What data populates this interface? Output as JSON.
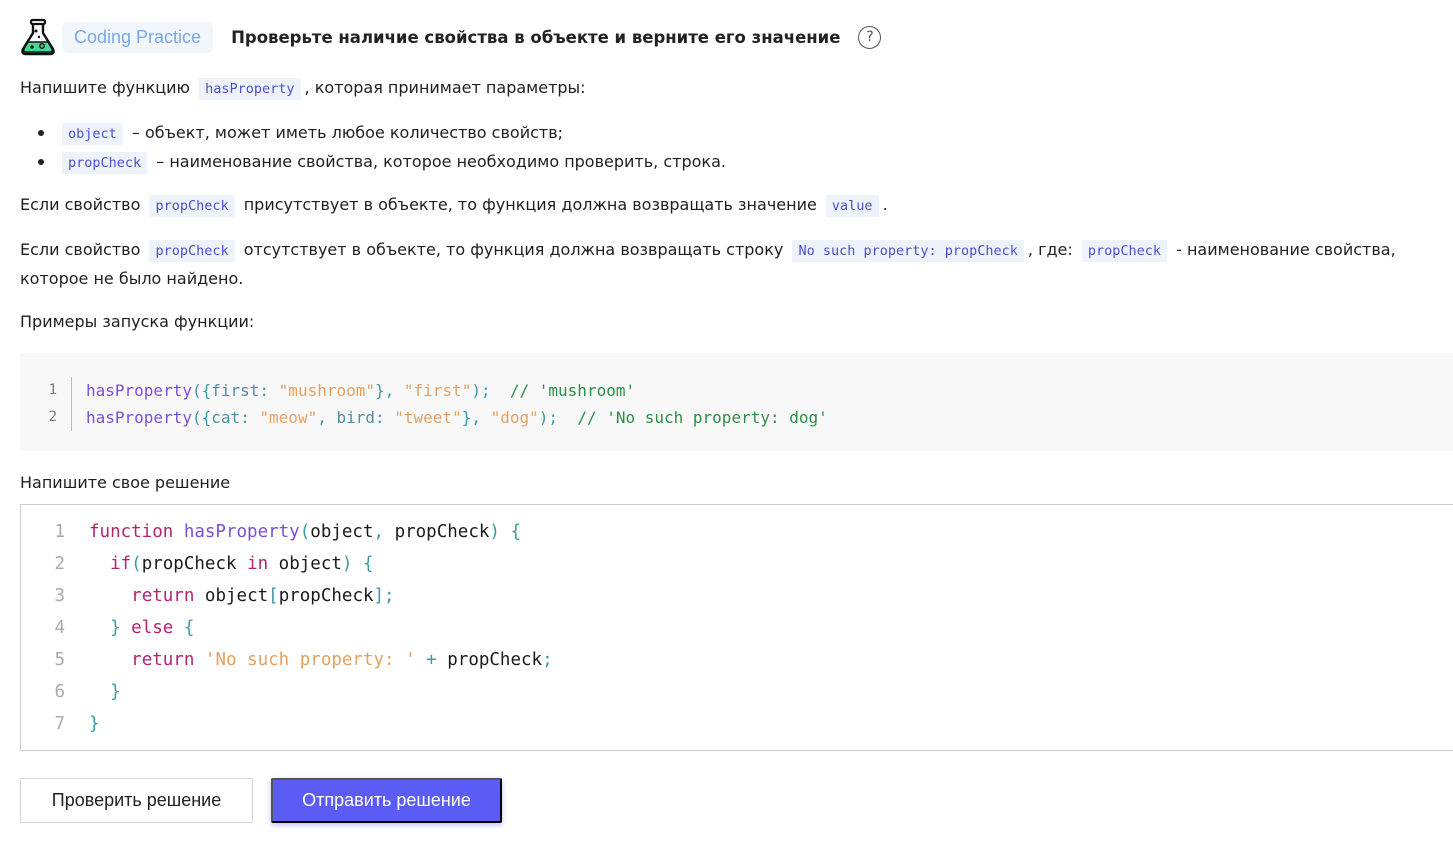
{
  "header": {
    "badge": "Coding Practice",
    "title": "Проверьте наличие свойства в объекте и верните его значение",
    "help_icon": "?"
  },
  "intro": {
    "before": "Напишите функцию",
    "code": "hasProperty",
    "after": ", которая принимает параметры:"
  },
  "params": [
    {
      "code": "object",
      "text": "– объект, может иметь любое количество свойств;"
    },
    {
      "code": "propCheck",
      "text": "– наименование свойства, которое необходимо проверить, строка."
    }
  ],
  "rule1": {
    "a": "Если свойство",
    "code1": "propCheck",
    "b": "присутствует в объекте, то функция должна возвращать значение",
    "code2": "value",
    "c": "."
  },
  "rule2": {
    "a": "Если свойство",
    "code1": "propCheck",
    "b": "отсутствует в объекте, то функция должна возвращать строку",
    "code2": "No such property: propCheck",
    "c": ", где:",
    "code3": "propCheck",
    "d": "- наименование свойства,",
    "e": "которое не было найдено."
  },
  "examples_label": "Примеры запуска функции:",
  "examples": [
    {
      "num": "1",
      "tokens": [
        [
          "fn",
          "hasProperty"
        ],
        [
          "punc",
          "({"
        ],
        [
          "key",
          "first: "
        ],
        [
          "str",
          "\"mushroom\""
        ],
        [
          "punc",
          "}, "
        ],
        [
          "str",
          "\"first\""
        ],
        [
          "punc",
          ");  "
        ],
        [
          "com",
          "// 'mushroom'"
        ]
      ]
    },
    {
      "num": "2",
      "tokens": [
        [
          "fn",
          "hasProperty"
        ],
        [
          "punc",
          "({"
        ],
        [
          "key",
          "cat: "
        ],
        [
          "str",
          "\"meow\""
        ],
        [
          "punc",
          ", "
        ],
        [
          "key",
          "bird: "
        ],
        [
          "str",
          "\"tweet\""
        ],
        [
          "punc",
          "}, "
        ],
        [
          "str",
          "\"dog\""
        ],
        [
          "punc",
          ");  "
        ],
        [
          "com",
          "// 'No such property: dog'"
        ]
      ]
    }
  ],
  "solution_label": "Напишите свое решение",
  "editor": [
    {
      "num": "1",
      "tokens": [
        [
          "kw",
          "function "
        ],
        [
          "fn",
          "hasProperty"
        ],
        [
          "punc",
          "("
        ],
        [
          "id",
          "object"
        ],
        [
          "punc",
          ", "
        ],
        [
          "id",
          "propCheck"
        ],
        [
          "punc",
          ") {"
        ]
      ]
    },
    {
      "num": "2",
      "tokens": [
        [
          "id",
          "  "
        ],
        [
          "kw",
          "if"
        ],
        [
          "punc",
          "("
        ],
        [
          "id",
          "propCheck "
        ],
        [
          "kw",
          "in "
        ],
        [
          "id",
          "object"
        ],
        [
          "punc",
          ") {"
        ]
      ]
    },
    {
      "num": "3",
      "tokens": [
        [
          "id",
          "    "
        ],
        [
          "kw",
          "return "
        ],
        [
          "id",
          "object"
        ],
        [
          "brk",
          "["
        ],
        [
          "id",
          "propCheck"
        ],
        [
          "brk",
          "];"
        ]
      ]
    },
    {
      "num": "4",
      "tokens": [
        [
          "id",
          "  "
        ],
        [
          "punc",
          "} "
        ],
        [
          "kw",
          "else "
        ],
        [
          "punc",
          "{"
        ]
      ]
    },
    {
      "num": "5",
      "tokens": [
        [
          "id",
          "    "
        ],
        [
          "kw",
          "return "
        ],
        [
          "str",
          "'No such property: '"
        ],
        [
          "punc",
          " + "
        ],
        [
          "id",
          "propCheck"
        ],
        [
          "punc",
          ";"
        ]
      ]
    },
    {
      "num": "6",
      "tokens": [
        [
          "id",
          "  "
        ],
        [
          "punc",
          "}"
        ]
      ]
    },
    {
      "num": "7",
      "tokens": [
        [
          "punc",
          "}"
        ]
      ]
    }
  ],
  "buttons": {
    "check": "Проверить решение",
    "submit": "Отправить решение"
  }
}
